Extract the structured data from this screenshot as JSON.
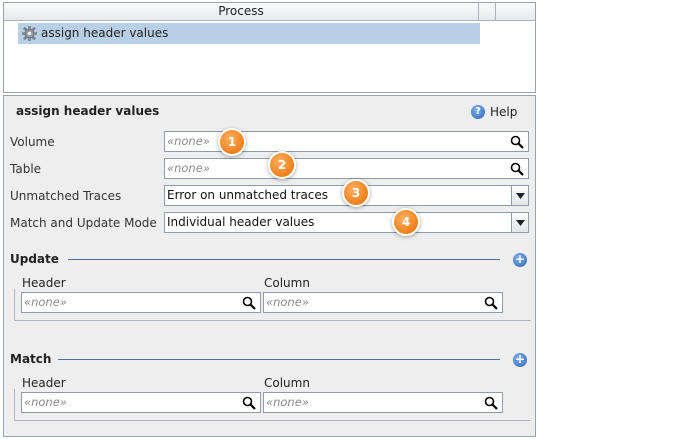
{
  "process_list": {
    "column_title": "Process",
    "rows": [
      {
        "label": "assign header values",
        "icon": "gear-icon",
        "selected": true
      }
    ]
  },
  "form": {
    "title": "assign header values",
    "help_label": "Help",
    "fields": {
      "volume": {
        "label": "Volume",
        "value": "«none»"
      },
      "table": {
        "label": "Table",
        "value": "«none»"
      },
      "unmatched_traces": {
        "label": "Unmatched Traces",
        "value": "Error on unmatched traces"
      },
      "match_mode": {
        "label": "Match and Update Mode",
        "value": "Individual header values"
      }
    },
    "badges": [
      "1",
      "2",
      "3",
      "4"
    ],
    "update": {
      "title": "Update",
      "header_col": "Header",
      "column_col": "Column",
      "row": {
        "header": "«none»",
        "column": "«none»"
      }
    },
    "match": {
      "title": "Match",
      "header_col": "Header",
      "column_col": "Column",
      "row": {
        "header": "«none»",
        "column": "«none»"
      }
    }
  },
  "colors": {
    "selection": "#b8cfe6",
    "badge": "#f07f1a",
    "accent": "#2c63b8",
    "panel_bg": "#eeeeee"
  }
}
